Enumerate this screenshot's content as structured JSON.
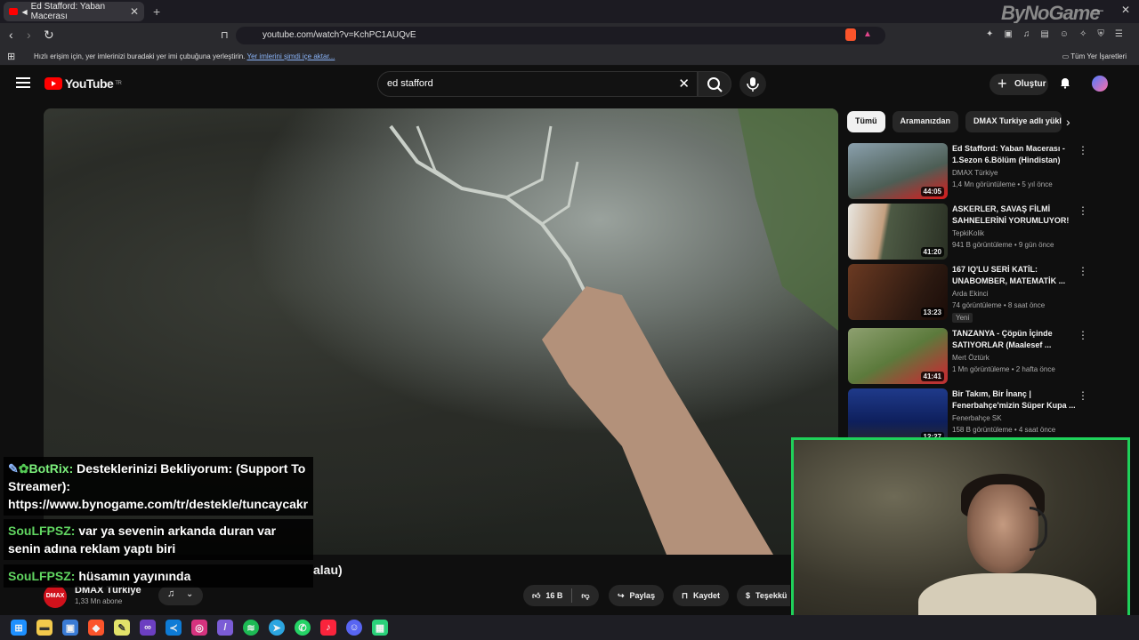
{
  "browser": {
    "tab_title": "Ed Stafford: Yaban Macerası",
    "url": "youtube.com/watch?v=KchPC1AUQvE",
    "bookmarks_hint": "Hızlı erişim için, yer imlerinizi buradaki yer imi çubuğuna yerleştirin.",
    "bookmarks_link": "Yer imlerini şimdi içe aktar...",
    "bookmarks_right": "Tüm Yer İşaretleri",
    "watermark": "ByNoGame"
  },
  "youtube": {
    "logo": "YouTube",
    "logo_country": "TR",
    "search_value": "ed stafford",
    "create_label": "Oluştur"
  },
  "chips": [
    "Tümü",
    "Aramanızdan",
    "DMAX Turkiye adlı yükle"
  ],
  "recommendations": [
    {
      "title": "Ed Stafford: Yaban Macerası - 1.Sezon 6.Bölüm (Hindistan)",
      "channel": "DMAX Türkiye",
      "meta": "1,4 Mn görüntüleme • 5 yıl önce",
      "duration": "44:05",
      "thumb_color": "#5a7a8c"
    },
    {
      "title": "ASKERLER, SAVAŞ FİLMİ SAHNELERİNİ YORUMLUYOR!",
      "channel": "TepkiKolik",
      "meta": "941 B görüntüleme • 9 gün önce",
      "duration": "41:20",
      "thumb_color": "#4d5a44"
    },
    {
      "title": "167 IQ'LU SERİ KATİL: UNABOMBER, MATEMATİK ...",
      "channel": "Arda Ekinci",
      "meta": "74 görüntüleme • 8 saat önce",
      "duration": "13:23",
      "thumb_color": "#6b3a22",
      "badge": "Yeni"
    },
    {
      "title": "TANZANYA - Çöpün İçinde SATIYORLAR (Maalesef ...",
      "channel": "Mert Öztürk",
      "meta": "1 Mn görüntüleme • 2 hafta önce",
      "duration": "41:41",
      "thumb_color": "#5c7a3c"
    },
    {
      "title": "Bir Takım, Bir İnanç | Fenerbahçe'mizin Süper Kupa ...",
      "channel": "Fenerbahçe SK",
      "meta": "158 B görüntüleme • 4 saat önce",
      "duration": "12:27",
      "thumb_color": "#1f3a8a"
    }
  ],
  "chat": [
    {
      "user": "BotRix:",
      "text": " Desteklerinizi Bekliyorum: (Support To Streamer): https://www.bynogame.com/tr/destekle/tuncaycakr"
    },
    {
      "user": "SouLFPSZ:",
      "text": " var ya sevenin arkanda duran var senin adına reklam yaptı biri"
    },
    {
      "user": "SouLFPSZ:",
      "text": " hüsamın yayınında"
    }
  ],
  "video": {
    "title_fragment": "alau)",
    "channel": "DMAX Türkiye",
    "channel_short": "DMAX",
    "subs": "1,33 Mn abone",
    "likes": "16 B",
    "share": "Paylaş",
    "save": "Kaydet",
    "thanks": "Teşekkü"
  }
}
